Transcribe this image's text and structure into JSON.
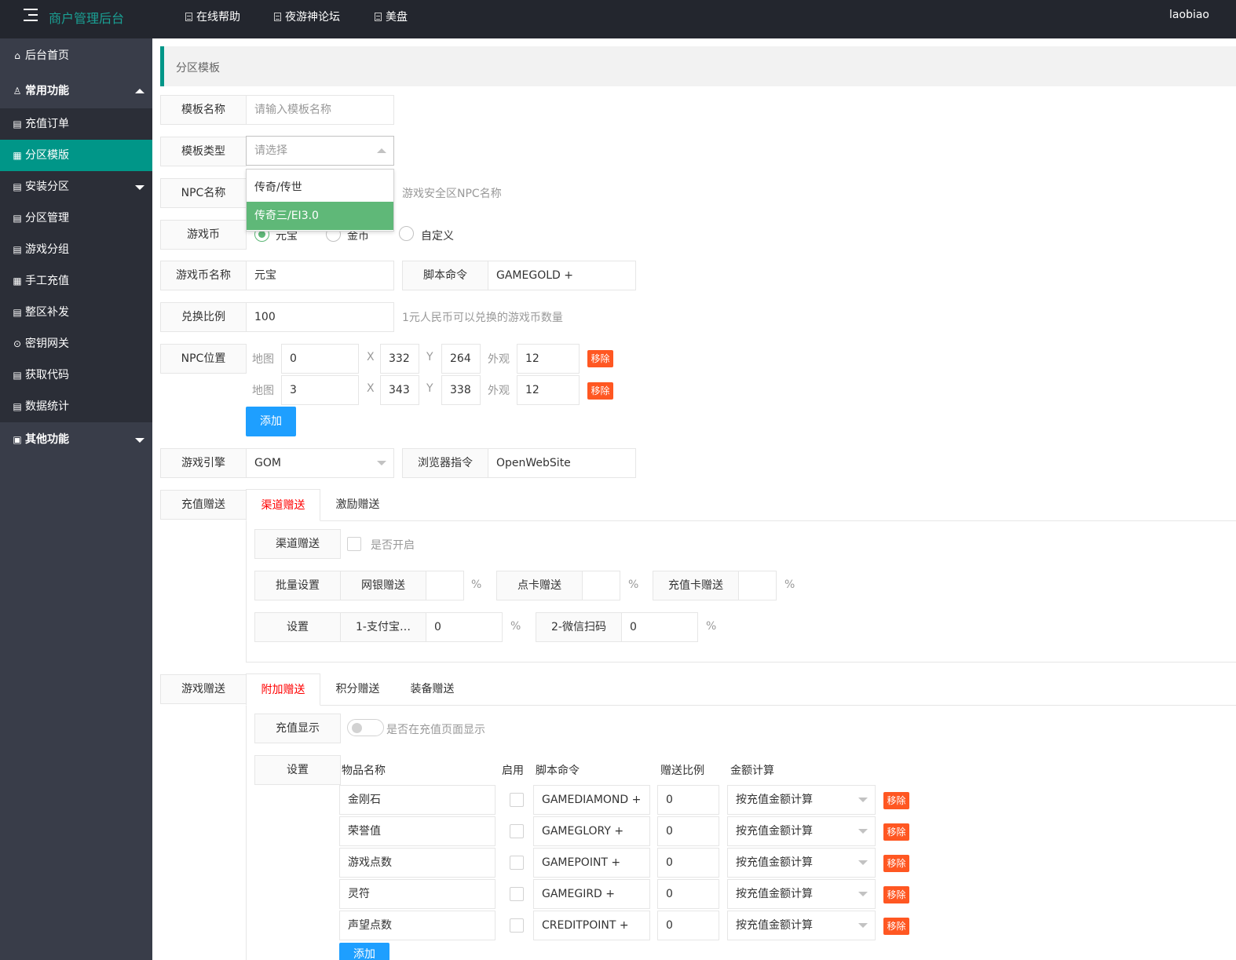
{
  "header": {
    "brand": "商户管理后台",
    "nav": [
      "在线帮助",
      "夜游神论坛",
      "美盘"
    ],
    "user": "laobiao"
  },
  "sidebar": {
    "home": "后台首页",
    "common": "常用功能",
    "items": [
      "充值订单",
      "分区模版",
      "安装分区",
      "分区管理",
      "游戏分组",
      "手工充值",
      "整区补发",
      "密钥网关",
      "获取代码",
      "数据统计"
    ],
    "other": "其他功能"
  },
  "breadcrumb": "分区模板",
  "form": {
    "template_name": {
      "label": "模板名称",
      "placeholder": "请输入模板名称"
    },
    "template_type": {
      "label": "模板类型",
      "placeholder": "请选择",
      "options": [
        "传奇/传世",
        "传奇三/EI3.0"
      ]
    },
    "npc_name": {
      "label": "NPC名称",
      "hint": "游戏安全区NPC名称"
    },
    "currency": {
      "label": "游戏币",
      "options": [
        "元宝",
        "金币",
        "自定义"
      ]
    },
    "currency_name": {
      "label": "游戏币名称",
      "value": "元宝"
    },
    "script_cmd": {
      "label": "脚本命令",
      "value": "GAMEGOLD +"
    },
    "ratio": {
      "label": "兑换比例",
      "value": "100",
      "hint": "1元人民币可以兑换的游戏币数量"
    },
    "npc_pos": {
      "label": "NPC位置",
      "map_label": "地图",
      "x_label": "X",
      "y_label": "Y",
      "look_label": "外观",
      "rows": [
        {
          "map": "0",
          "x": "332",
          "y": "264",
          "look": "12"
        },
        {
          "map": "3",
          "x": "343",
          "y": "338",
          "look": "12"
        }
      ],
      "remove": "移除",
      "add": "添加"
    },
    "engine": {
      "label": "游戏引擎",
      "value": "GOM"
    },
    "browser_cmd": {
      "label": "浏览器指令",
      "value": "OpenWebSite"
    }
  },
  "recharge_gift": {
    "label": "充值赠送",
    "tabs": [
      "渠道赠送",
      "激励赠送"
    ],
    "channel_gift_label": "渠道赠送",
    "enable_hint": "是否开启",
    "batch_label": "批量设置",
    "batch_items": [
      {
        "label": "网银赠送",
        "value": ""
      },
      {
        "label": "点卡赠送",
        "value": ""
      },
      {
        "label": "充值卡赠送",
        "value": ""
      }
    ],
    "set_label": "设置",
    "set_items": [
      {
        "label": "1-支付宝…",
        "value": "0"
      },
      {
        "label": "2-微信扫码",
        "value": "0"
      }
    ],
    "percent": "%"
  },
  "game_gift": {
    "label": "游戏赠送",
    "tabs": [
      "附加赠送",
      "积分赠送",
      "装备赠送"
    ],
    "display_label": "充值显示",
    "display_hint": "是否在充值页面显示",
    "set_label": "设置",
    "headers": [
      "物品名称",
      "启用",
      "脚本命令",
      "赠送比例",
      "金额计算"
    ],
    "rows": [
      {
        "name": "金刚石",
        "cmd": "GAMEDIAMOND +",
        "ratio": "0",
        "calc": "按充值金额计算"
      },
      {
        "name": "荣誉值",
        "cmd": "GAMEGLORY +",
        "ratio": "0",
        "calc": "按充值金额计算"
      },
      {
        "name": "游戏点数",
        "cmd": "GAMEPOINT +",
        "ratio": "0",
        "calc": "按充值金额计算"
      },
      {
        "name": "灵符",
        "cmd": "GAMEGIRD +",
        "ratio": "0",
        "calc": "按充值金额计算"
      },
      {
        "name": "声望点数",
        "cmd": "CREDITPOINT +",
        "ratio": "0",
        "calc": "按充值金额计算"
      }
    ],
    "remove": "移除",
    "add": "添加"
  },
  "colors": {
    "header_bg": "#23262e",
    "sidebar_bg": "#393d49",
    "active": "#009688",
    "danger": "#ff5722",
    "primary": "#1e9fff",
    "selected_option": "#5fb878"
  }
}
